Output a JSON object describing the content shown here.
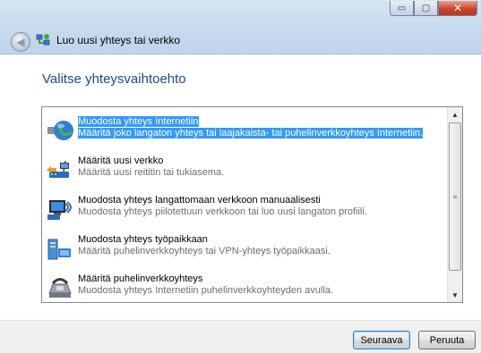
{
  "window": {
    "title": "Luo uusi yhteys tai verkko",
    "caption_buttons": {
      "minimize": "▭",
      "maximize": "▢",
      "close": "✕"
    }
  },
  "main": {
    "heading": "Valitse yhteysvaihtoehto"
  },
  "options": [
    {
      "title": "Muodosta yhteys Internetiin",
      "description": "Määritä joko langaton yhteys tai laajakaista- tai puhelinverkkoyhteys Internetiin.",
      "icon": "globe-icon",
      "selected": true
    },
    {
      "title": "Määritä uusi verkko",
      "description": "Määritä uusi reititin tai tukiasema.",
      "icon": "router-icon",
      "selected": false
    },
    {
      "title": "Muodosta yhteys langattomaan verkkoon manuaalisesti",
      "description": "Muodosta yhteys piilotettuun verkkoon tai luo uusi langaton profiili.",
      "icon": "wireless-network-icon",
      "selected": false
    },
    {
      "title": "Muodosta yhteys työpaikkaan",
      "description": "Määritä puhelinverkkoyhteys tai VPN-yhteys työpaikkaasi.",
      "icon": "workplace-icon",
      "selected": false
    },
    {
      "title": "Määritä puhelinverkkoyhteys",
      "description": "Muodosta yhteys Internetiin puhelinverkkoyhteyden avulla.",
      "icon": "modem-phone-icon",
      "selected": false
    }
  ],
  "buttons": {
    "next": "Seuraava",
    "cancel": "Peruuta"
  },
  "colors": {
    "selection": "#3399ff",
    "heading": "#1e4a8a"
  }
}
